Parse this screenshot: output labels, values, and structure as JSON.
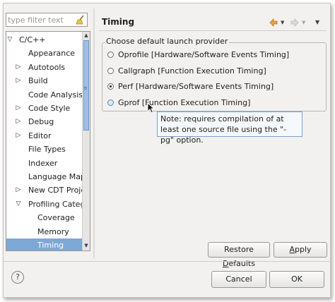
{
  "filter": {
    "placeholder": "type filter text"
  },
  "tree": {
    "items": [
      {
        "label": "C/C++",
        "expander": "expanded",
        "depth": 0
      },
      {
        "label": "Appearance",
        "expander": "none",
        "depth": 1
      },
      {
        "label": "Autotools",
        "expander": "collapsed",
        "depth": 1
      },
      {
        "label": "Build",
        "expander": "collapsed",
        "depth": 1
      },
      {
        "label": "Code Analysis",
        "expander": "none",
        "depth": 1
      },
      {
        "label": "Code Style",
        "expander": "collapsed",
        "depth": 1
      },
      {
        "label": "Debug",
        "expander": "collapsed",
        "depth": 1
      },
      {
        "label": "Editor",
        "expander": "collapsed",
        "depth": 1
      },
      {
        "label": "File Types",
        "expander": "none",
        "depth": 1
      },
      {
        "label": "Indexer",
        "expander": "none",
        "depth": 1
      },
      {
        "label": "Language Mappi",
        "expander": "none",
        "depth": 1
      },
      {
        "label": "New CDT Projec",
        "expander": "collapsed",
        "depth": 1
      },
      {
        "label": "Profiling Catego",
        "expander": "expanded",
        "depth": 1
      },
      {
        "label": "Coverage",
        "expander": "none",
        "depth": 2
      },
      {
        "label": "Memory",
        "expander": "none",
        "depth": 2
      },
      {
        "label": "Timing",
        "expander": "none",
        "depth": 2,
        "selected": true
      }
    ]
  },
  "page": {
    "title": "Timing"
  },
  "group": {
    "legend": "Choose default launch provider",
    "options": [
      {
        "label": "Oprofile [Hardware/Software Events Timing]",
        "checked": false
      },
      {
        "label": "Callgraph [Function Execution Timing]",
        "checked": false
      },
      {
        "label": "Perf [Hardware/Software Events Timing]",
        "checked": true
      },
      {
        "label": "Gprof [Function Execution Timing]",
        "checked": false,
        "hover": true
      }
    ]
  },
  "tooltip": {
    "text": "Note: requires compilation of at least one source file using the \"-pg\" option."
  },
  "buttons": {
    "restore_pre": "Restore ",
    "restore_ul": "D",
    "restore_post": "efaults",
    "apply_pre": "",
    "apply_ul": "A",
    "apply_post": "pply",
    "cancel": "Cancel",
    "ok": "OK",
    "help": "?"
  },
  "colors": {
    "selection": "#7ea8d6",
    "accent": "#e9a23b"
  },
  "icons": {
    "back": "back-arrow-icon",
    "forward": "forward-arrow-icon",
    "menu": "view-menu-icon",
    "clear": "clear-filter-icon"
  }
}
